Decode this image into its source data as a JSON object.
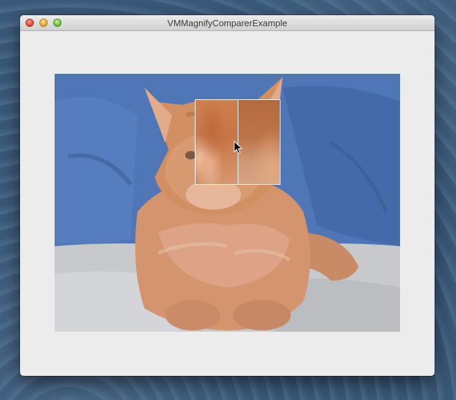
{
  "window": {
    "title": "VMMagnifyComparerExample"
  },
  "icons": {
    "close": "close-traffic-light-icon",
    "minimize": "minimize-traffic-light-icon",
    "zoom": "zoom-traffic-light-icon",
    "cursor": "arrow-cursor-icon"
  },
  "colors": {
    "desktop": "#3d5b7b",
    "window_bg": "#ececec",
    "photo_background": "#4d72b4",
    "cat_fur": "#d8956a",
    "magnifier_border": "#ffffff"
  },
  "image_view": {
    "content": "photo of a fluffy orange kitten sitting on a white blanket in front of a blue couch",
    "magnifier": {
      "panes": [
        "original",
        "comparison"
      ]
    }
  }
}
